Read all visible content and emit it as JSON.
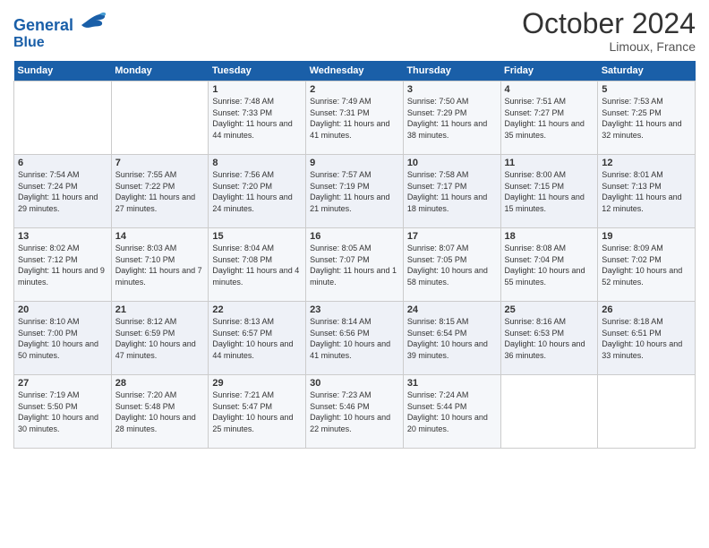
{
  "header": {
    "logo_line1": "General",
    "logo_line2": "Blue",
    "month": "October 2024",
    "location": "Limoux, France"
  },
  "days_of_week": [
    "Sunday",
    "Monday",
    "Tuesday",
    "Wednesday",
    "Thursday",
    "Friday",
    "Saturday"
  ],
  "weeks": [
    [
      {
        "day": "",
        "detail": ""
      },
      {
        "day": "",
        "detail": ""
      },
      {
        "day": "1",
        "detail": "Sunrise: 7:48 AM\nSunset: 7:33 PM\nDaylight: 11 hours and 44 minutes."
      },
      {
        "day": "2",
        "detail": "Sunrise: 7:49 AM\nSunset: 7:31 PM\nDaylight: 11 hours and 41 minutes."
      },
      {
        "day": "3",
        "detail": "Sunrise: 7:50 AM\nSunset: 7:29 PM\nDaylight: 11 hours and 38 minutes."
      },
      {
        "day": "4",
        "detail": "Sunrise: 7:51 AM\nSunset: 7:27 PM\nDaylight: 11 hours and 35 minutes."
      },
      {
        "day": "5",
        "detail": "Sunrise: 7:53 AM\nSunset: 7:25 PM\nDaylight: 11 hours and 32 minutes."
      }
    ],
    [
      {
        "day": "6",
        "detail": "Sunrise: 7:54 AM\nSunset: 7:24 PM\nDaylight: 11 hours and 29 minutes."
      },
      {
        "day": "7",
        "detail": "Sunrise: 7:55 AM\nSunset: 7:22 PM\nDaylight: 11 hours and 27 minutes."
      },
      {
        "day": "8",
        "detail": "Sunrise: 7:56 AM\nSunset: 7:20 PM\nDaylight: 11 hours and 24 minutes."
      },
      {
        "day": "9",
        "detail": "Sunrise: 7:57 AM\nSunset: 7:19 PM\nDaylight: 11 hours and 21 minutes."
      },
      {
        "day": "10",
        "detail": "Sunrise: 7:58 AM\nSunset: 7:17 PM\nDaylight: 11 hours and 18 minutes."
      },
      {
        "day": "11",
        "detail": "Sunrise: 8:00 AM\nSunset: 7:15 PM\nDaylight: 11 hours and 15 minutes."
      },
      {
        "day": "12",
        "detail": "Sunrise: 8:01 AM\nSunset: 7:13 PM\nDaylight: 11 hours and 12 minutes."
      }
    ],
    [
      {
        "day": "13",
        "detail": "Sunrise: 8:02 AM\nSunset: 7:12 PM\nDaylight: 11 hours and 9 minutes."
      },
      {
        "day": "14",
        "detail": "Sunrise: 8:03 AM\nSunset: 7:10 PM\nDaylight: 11 hours and 7 minutes."
      },
      {
        "day": "15",
        "detail": "Sunrise: 8:04 AM\nSunset: 7:08 PM\nDaylight: 11 hours and 4 minutes."
      },
      {
        "day": "16",
        "detail": "Sunrise: 8:05 AM\nSunset: 7:07 PM\nDaylight: 11 hours and 1 minute."
      },
      {
        "day": "17",
        "detail": "Sunrise: 8:07 AM\nSunset: 7:05 PM\nDaylight: 10 hours and 58 minutes."
      },
      {
        "day": "18",
        "detail": "Sunrise: 8:08 AM\nSunset: 7:04 PM\nDaylight: 10 hours and 55 minutes."
      },
      {
        "day": "19",
        "detail": "Sunrise: 8:09 AM\nSunset: 7:02 PM\nDaylight: 10 hours and 52 minutes."
      }
    ],
    [
      {
        "day": "20",
        "detail": "Sunrise: 8:10 AM\nSunset: 7:00 PM\nDaylight: 10 hours and 50 minutes."
      },
      {
        "day": "21",
        "detail": "Sunrise: 8:12 AM\nSunset: 6:59 PM\nDaylight: 10 hours and 47 minutes."
      },
      {
        "day": "22",
        "detail": "Sunrise: 8:13 AM\nSunset: 6:57 PM\nDaylight: 10 hours and 44 minutes."
      },
      {
        "day": "23",
        "detail": "Sunrise: 8:14 AM\nSunset: 6:56 PM\nDaylight: 10 hours and 41 minutes."
      },
      {
        "day": "24",
        "detail": "Sunrise: 8:15 AM\nSunset: 6:54 PM\nDaylight: 10 hours and 39 minutes."
      },
      {
        "day": "25",
        "detail": "Sunrise: 8:16 AM\nSunset: 6:53 PM\nDaylight: 10 hours and 36 minutes."
      },
      {
        "day": "26",
        "detail": "Sunrise: 8:18 AM\nSunset: 6:51 PM\nDaylight: 10 hours and 33 minutes."
      }
    ],
    [
      {
        "day": "27",
        "detail": "Sunrise: 7:19 AM\nSunset: 5:50 PM\nDaylight: 10 hours and 30 minutes."
      },
      {
        "day": "28",
        "detail": "Sunrise: 7:20 AM\nSunset: 5:48 PM\nDaylight: 10 hours and 28 minutes."
      },
      {
        "day": "29",
        "detail": "Sunrise: 7:21 AM\nSunset: 5:47 PM\nDaylight: 10 hours and 25 minutes."
      },
      {
        "day": "30",
        "detail": "Sunrise: 7:23 AM\nSunset: 5:46 PM\nDaylight: 10 hours and 22 minutes."
      },
      {
        "day": "31",
        "detail": "Sunrise: 7:24 AM\nSunset: 5:44 PM\nDaylight: 10 hours and 20 minutes."
      },
      {
        "day": "",
        "detail": ""
      },
      {
        "day": "",
        "detail": ""
      }
    ]
  ]
}
